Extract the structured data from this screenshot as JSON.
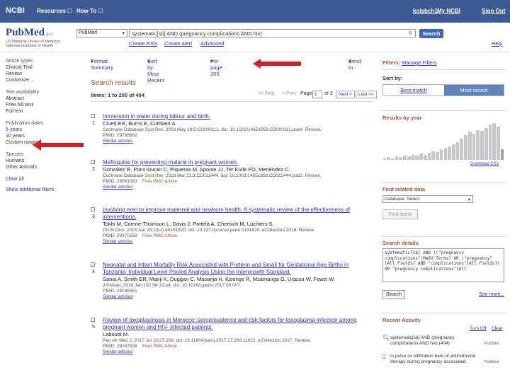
{
  "topnav": {
    "brand": "NCBI",
    "resources": "Resources",
    "howto": "How To",
    "username": "kolsbch1",
    "my_ncbi": "My NCBI",
    "sign_out": "Sign Out"
  },
  "header": {
    "logo": "PubMed",
    "logo_gov": ".gov",
    "logo_sub1": "US National Library of Medicine",
    "logo_sub2": "National Institutes of Health",
    "db": "PubMed",
    "query": "systematic[sb] AND (pregnancy complications AND hiv)",
    "search_button": "Search",
    "create_rss": "Create RSS",
    "create_alert": "Create alert",
    "advanced": "Advanced",
    "help": "Help"
  },
  "left_filters": {
    "groups": [
      {
        "heading": "Article types",
        "items": [
          "Clinical Trial",
          "Review",
          "Customize ..."
        ]
      },
      {
        "heading": "Text availability",
        "items": [
          "Abstract",
          "Free full text",
          "Full text"
        ]
      },
      {
        "heading": "Publication dates",
        "items": [
          "5 years",
          "10 years",
          "Custom range..."
        ]
      },
      {
        "heading": "Species",
        "items": [
          "Humans",
          "Other Animals"
        ]
      }
    ],
    "clear_all": "Clear all",
    "show_additional": "Show additional filters"
  },
  "display_bar": {
    "format": "Format: Summary",
    "sort": "Sort by: Most Recent",
    "per_page": "Per page: 200",
    "send_to": "Send to"
  },
  "results": {
    "title": "Search results",
    "items_count": "Items: 1 to 200 of 404",
    "pager": {
      "first": "<< First",
      "prev": "< Prev",
      "page_label": "Page",
      "page_value": "1",
      "of_label": "of 3",
      "next": "Next >",
      "last": "Last >>"
    },
    "list": [
      {
        "num": "1.",
        "title": "Immersion in water during labour and birth.",
        "authors": "Cluett ER, Burns E, Cuthbert A.",
        "source": "Cochrane Database Syst Rev. 2018 May 16;5:CD000111. doi: 10.1002/14651858.CD000111.pub4. Review.",
        "pmid": "PMID: 29768662",
        "free": "",
        "similar": "Similar articles"
      },
      {
        "num": "2.",
        "title": "Mefloquine for preventing malaria in pregnant women.",
        "authors": "González R, Pons-Duran C, Piqueras M, Aponte JJ, Ter Kuile FO, Menéndez C.",
        "source": "Cochrane Database Syst Rev. 2018 Mar 21;3:CD011444. doi: 10.1002/14651858.CD011444.pub2. Review.",
        "pmid": "PMID: 29561063",
        "free": "Free PMC Article",
        "similar": "Similar articles"
      },
      {
        "num": "3.",
        "title": "Involving men to improve maternal and newborn health: A systematic review of the effectiveness of interventions.",
        "authors": "Tokhi M, Comrie-Thomson L, Davis J, Portela A, Chersich M, Luchters S.",
        "source": "PLoS One. 2018 Jan 25;13(1):e0191620. doi: 10.1371/journal.pone.0191620. eCollection 2018. Review.",
        "pmid": "PMID: 29370258",
        "free": "Free PMC Article",
        "similar": "Similar articles"
      },
      {
        "num": "4.",
        "title": "Neonatal and Infant Mortality Risk Associated with Preterm and Small for Gestational Age Births in Tanzania: Individual Level Pooled Analysis Using the Intergrowth Standard.",
        "authors": "Sania A, Smith ER, Manji K, Duggan C, Masanja H, Kisenge R, Msamanga G, Urassa W, Fawzi W.",
        "source": "J Pediatr. 2018 Jan;192:66-72.e4. doi: 10.1016/j.jpeds.2017.09.007.",
        "pmid": "PMID: 29246361",
        "free": "",
        "similar": "Similar articles"
      },
      {
        "num": "5.",
        "title": "Review of toxoplasmosis in Morocco: seroprevalence and risk factors for toxoplasma infection among pregnant women and HIV- infected patients.",
        "authors": "Laboudi M.",
        "source": "Pan Afr Med J. 2017 Jul 10;27:269. doi: 10.11604/pamj.2017.27.269.11822. eCollection 2017. Review.",
        "pmid": "PMID: 29187938",
        "free": "Free PMC Article",
        "similar": "Similar articles"
      }
    ]
  },
  "right_panel": {
    "filters_label": "Filters:",
    "manage_filters": "Manage Filters",
    "sort_by": "Sort by:",
    "best_match": "Best match",
    "most_recent": "Most recent",
    "results_by_year": "Results by year",
    "year_values": [
      2,
      3,
      2,
      4,
      3,
      5,
      4,
      6,
      5,
      7,
      6,
      8,
      10,
      9,
      12,
      14,
      15,
      18,
      20,
      24,
      28,
      32,
      30,
      34,
      33,
      36,
      40,
      42,
      38,
      12
    ],
    "download_csv": "Download CSV",
    "find_related": "Find related data",
    "database_label": "Database:",
    "database_value": "Select",
    "find_items": "Find items",
    "search_details": "Search details",
    "search_details_text": "systematic[sb] AND ((\"pregnancy complications\"[MeSH Terms] OR (\"pregnancy\"[All Fields] AND \"complications\"[All Fields]) OR \"pregnancy complications\"[All",
    "search_button": "Search",
    "see_more": "See more...",
    "recent_activity": "Recent Activity",
    "turn_off": "Turn Off",
    "clear": "Clear",
    "activity": [
      {
        "text": "systematic[sb] AND (pregnancy complications AND hiv) (404)",
        "source": "PubMed"
      },
      {
        "text": "Is pulse ox infiltration bare of antiretroviral therapy during pregnancy associated",
        "source": "PubMed"
      }
    ]
  }
}
